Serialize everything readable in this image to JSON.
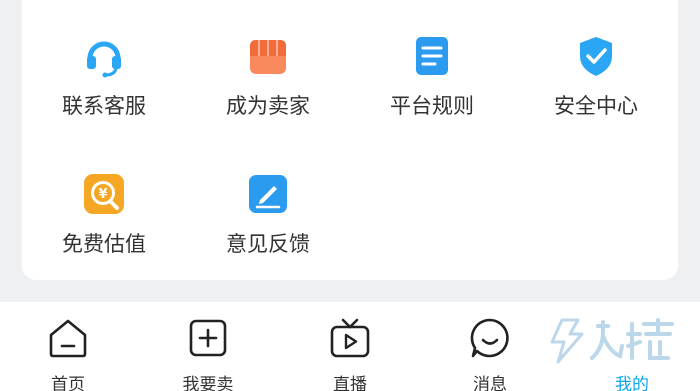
{
  "services": [
    {
      "label": "联系客服",
      "icon": "headset-icon",
      "color": "#2aa6f4"
    },
    {
      "label": "成为卖家",
      "icon": "shop-icon",
      "color": "#f26b3a"
    },
    {
      "label": "平台规则",
      "icon": "document-icon",
      "color": "#2b9bf0"
    },
    {
      "label": "安全中心",
      "icon": "shield-check-icon",
      "color": "#2aa6f4"
    },
    {
      "label": "免费估值",
      "icon": "yuan-search-icon",
      "color": "#f5a623"
    },
    {
      "label": "意见反馈",
      "icon": "edit-icon",
      "color": "#2b9bf0"
    }
  ],
  "tabbar": {
    "items": [
      {
        "label": "首页",
        "icon": "home-icon",
        "active": false
      },
      {
        "label": "我要卖",
        "icon": "plus-square-icon",
        "active": false
      },
      {
        "label": "直播",
        "icon": "tv-play-icon",
        "active": false
      },
      {
        "label": "消息",
        "icon": "chat-icon",
        "active": false
      },
      {
        "label": "我的",
        "icon": "profile-icon",
        "active": true
      }
    ],
    "active_color": "#10a5e8"
  }
}
